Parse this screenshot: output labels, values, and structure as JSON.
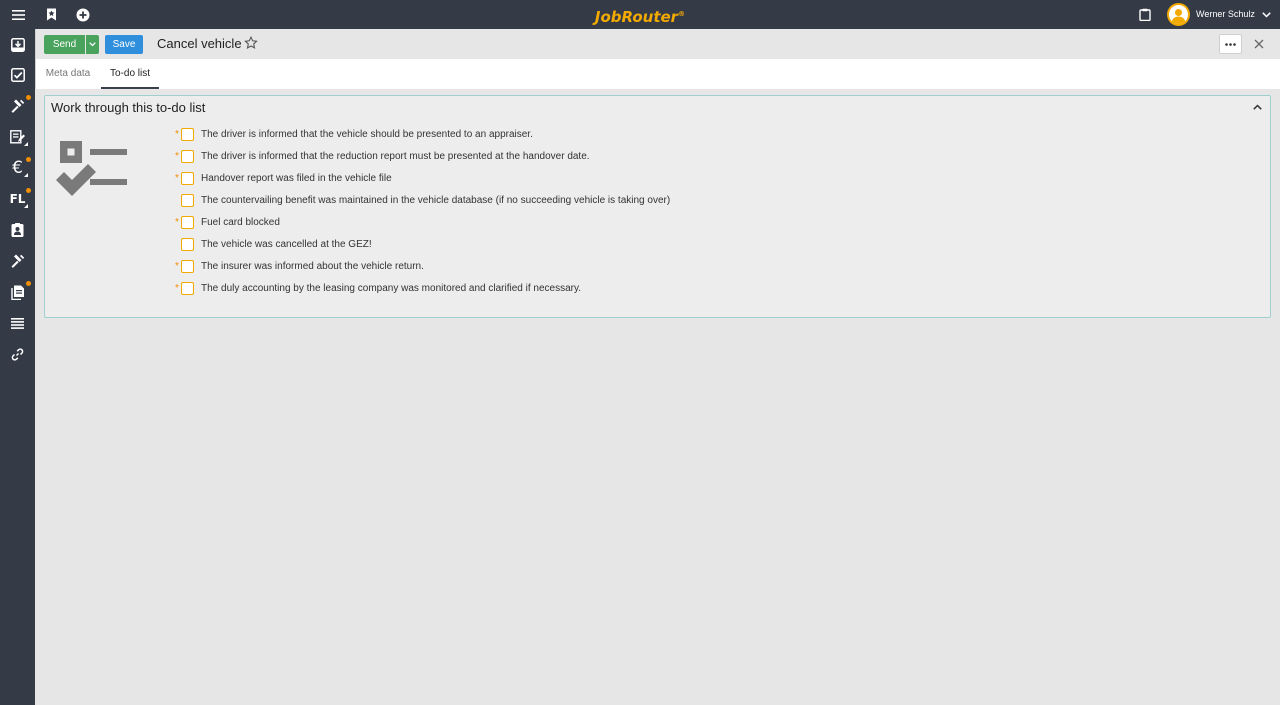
{
  "app": {
    "logo": "JobRouter",
    "logo_mark": "®",
    "user_name": "Werner Schulz"
  },
  "sidebar": {
    "items": [
      {
        "icon": "inbox-icon"
      },
      {
        "icon": "check-square-icon"
      },
      {
        "icon": "hammer-icon",
        "badge": true
      },
      {
        "icon": "form-edit-icon",
        "corner": true
      },
      {
        "icon": "euro-icon",
        "text": "€",
        "badge": true,
        "corner": true
      },
      {
        "icon": "fleet-icon",
        "text": "FL",
        "badge": true,
        "corner": true
      },
      {
        "icon": "contact-card-icon"
      },
      {
        "icon": "hammer-icon"
      },
      {
        "icon": "documents-icon",
        "badge": true
      },
      {
        "icon": "list-icon"
      },
      {
        "icon": "link-icon"
      }
    ]
  },
  "toolbar": {
    "send_label": "Send",
    "save_label": "Save",
    "title": "Cancel vehicle"
  },
  "tabs": [
    {
      "label": "Meta data",
      "active": false
    },
    {
      "label": "To-do list",
      "active": true
    }
  ],
  "panel": {
    "title": "Work through this to-do list",
    "items": [
      {
        "required": true,
        "label": "The driver is informed that the vehicle should be presented to an appraiser."
      },
      {
        "required": true,
        "label": "The driver is informed that the reduction report must be presented at the handover date."
      },
      {
        "required": true,
        "label": "Handover report was filed in the vehicle file"
      },
      {
        "required": false,
        "label": "The countervailing benefit was maintained in the vehicle database (if no succeeding vehicle is taking over)"
      },
      {
        "required": true,
        "label": "Fuel card blocked"
      },
      {
        "required": false,
        "label": "The vehicle was cancelled at the GEZ!"
      },
      {
        "required": true,
        "label": "The insurer was informed about the vehicle return."
      },
      {
        "required": true,
        "label": "The duly accounting by the leasing company was monitored and clarified if necessary."
      }
    ]
  },
  "colors": {
    "topbar": "#353a47",
    "logo": "#f2a900",
    "send": "#4aa35d",
    "save": "#2f8fdc",
    "badge": "#f28e00",
    "checkbox_border": "#f2a900"
  }
}
